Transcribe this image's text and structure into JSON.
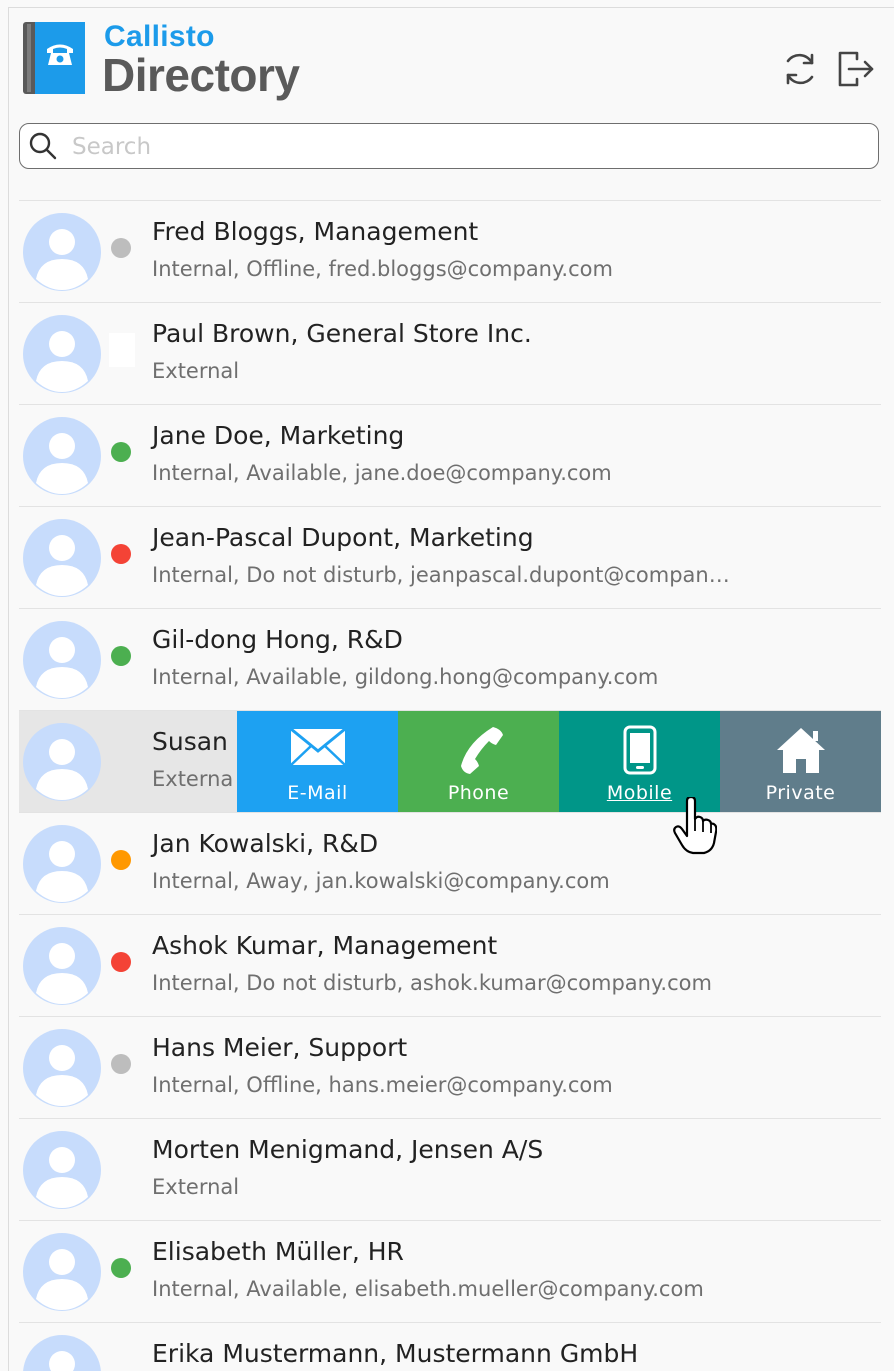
{
  "app": {
    "brand_top": "Callisto",
    "brand_main": "Directory",
    "icons": {
      "logo": "phone-book-icon",
      "refresh": "refresh-icon",
      "logout": "logout-icon"
    }
  },
  "search": {
    "placeholder": "Search",
    "value": ""
  },
  "status_colors": {
    "offline": "#bdbdbd",
    "available": "#4caf50",
    "dnd": "#f44336",
    "away": "#ff9800"
  },
  "contacts": [
    {
      "name": "Fred Bloggs, Management",
      "detail": "Internal, Offline, fred.bloggs@company.com",
      "status": "offline"
    },
    {
      "name": "Paul Brown, General Store Inc.",
      "detail": "External",
      "status": "none"
    },
    {
      "name": "Jane Doe, Marketing",
      "detail": "Internal, Available, jane.doe@company.com",
      "status": "available"
    },
    {
      "name": "Jean-Pascal Dupont, Marketing",
      "detail": "Internal, Do not disturb, jeanpascal.dupont@compan…",
      "status": "dnd"
    },
    {
      "name": "Gil-dong Hong, R&D",
      "detail": "Internal, Available, gildong.hong@company.com",
      "status": "available"
    },
    {
      "name": "Susan",
      "detail": "Externa",
      "status": "none",
      "selected": true
    },
    {
      "name": "Jan Kowalski, R&D",
      "detail": "Internal, Away, jan.kowalski@company.com",
      "status": "away"
    },
    {
      "name": "Ashok Kumar, Management",
      "detail": "Internal, Do not disturb, ashok.kumar@company.com",
      "status": "dnd"
    },
    {
      "name": "Hans Meier, Support",
      "detail": "Internal, Offline, hans.meier@company.com",
      "status": "offline"
    },
    {
      "name": "Morten Menigmand, Jensen A/S",
      "detail": "External",
      "status": "none"
    },
    {
      "name": "Elisabeth Müller, HR",
      "detail": "Internal, Available, elisabeth.mueller@company.com",
      "status": "available"
    },
    {
      "name": "Erika Mustermann, Mustermann GmbH",
      "detail": "",
      "status": "none"
    }
  ],
  "actions": [
    {
      "label": "E-Mail",
      "icon": "envelope-icon",
      "color": "#1da1f2"
    },
    {
      "label": "Phone",
      "icon": "phone-handset-icon",
      "color": "#4caf50"
    },
    {
      "label": "Mobile",
      "icon": "mobile-phone-icon",
      "color": "#009688"
    },
    {
      "label": "Private",
      "icon": "home-icon",
      "color": "#607d8b"
    }
  ]
}
